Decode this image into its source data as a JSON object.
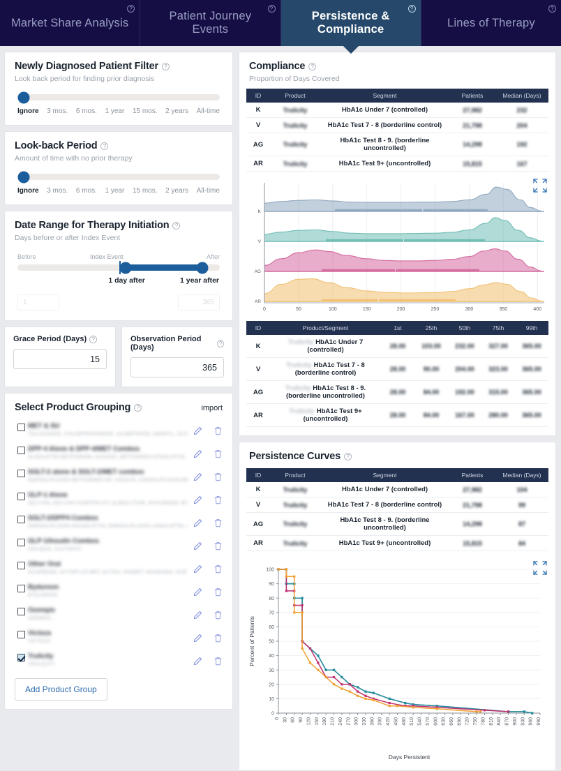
{
  "tabs": [
    {
      "label": "Market Share Analysis",
      "active": false
    },
    {
      "label": "Patient Journey Events",
      "active": false
    },
    {
      "label": "Persistence & Compliance",
      "active": true
    },
    {
      "label": "Lines of Therapy",
      "active": false
    }
  ],
  "newly_diagnosed": {
    "title": "Newly Diagnosed Patient Filter",
    "subtitle": "Look back period for finding prior diagnosis",
    "ticks": [
      "Ignore",
      "3 mos.",
      "6 mos.",
      "1 year",
      "15 mos.",
      "2 years",
      "All-time"
    ],
    "selected": "Ignore"
  },
  "lookback": {
    "title": "Look-back Period",
    "subtitle": "Amount of time with no prior therapy",
    "ticks": [
      "Ignore",
      "3 mos.",
      "6 mos.",
      "1 year",
      "15 mos.",
      "2 years",
      "All-time"
    ],
    "selected": "Ignore"
  },
  "date_range": {
    "title": "Date Range for Therapy Initiation",
    "subtitle": "Days before or after Index Event",
    "left_label": "Before",
    "mid_label": "Index Event",
    "right_label": "After",
    "low_value_label": "1 day after",
    "high_value_label": "1 year after",
    "low_input": "1",
    "high_input": "365"
  },
  "grace_period": {
    "label": "Grace Period (Days)",
    "value": "15"
  },
  "observation_period": {
    "label": "Observation Period (Days)",
    "value": "365"
  },
  "product_grouping": {
    "title": "Select Product Grouping",
    "import_label": "import",
    "add_button": "Add Product Group",
    "items": [
      {
        "name": "MET & SU",
        "drugs": "TOLAZAMIDE, CHLORPROPAMIDE, GLIMEPIRIDE, AMARYL, GLIPIZ...",
        "checked": false
      },
      {
        "name": "DPP-4 Alone & DPP-4/MET Combos",
        "drugs": "ALOGLIPTIN-METFORMIN, KAZANO, METFORMIN-SITAGLIPTIN, JA...",
        "checked": false
      },
      {
        "name": "SGLT-2 alone & SGLT-2/MET combos",
        "drugs": "EMPAGLIFLOZIN-METFORMIN HR, XIGDUO, CANAGLIFLOZIN-MET...",
        "checked": false
      },
      {
        "name": "GLP-1 Alone",
        "drugs": "ADLYXIN, ADLYXIN STARTER KIT, ALBIGLUTIDE, BYDUREON, BYETT...",
        "checked": false
      },
      {
        "name": "SGLT-2/DPP4 Combos",
        "drugs": "EMPAGLIFLOZIN-SAXAGLIPTIN, EMPAGLIFLOZIN-LINAGLIPTIN, GL...",
        "checked": false
      },
      {
        "name": "GLP-1/Insulin Combos",
        "drugs": "SOLIQUA, XULTOPHY",
        "checked": false
      },
      {
        "name": "Other Oral",
        "drugs": "ACARBOSE, ACTOPLUS MET, ACTOS, RIOMET, INVOKANA, DUET...",
        "checked": false
      },
      {
        "name": "Bydureon",
        "drugs": "BYDUREON",
        "checked": false
      },
      {
        "name": "Ozempic",
        "drugs": "OZEMPIC",
        "checked": false
      },
      {
        "name": "Victoza",
        "drugs": "VICTOZA",
        "checked": false
      },
      {
        "name": "Trulicity",
        "drugs": "TRULICITY",
        "checked": true
      }
    ]
  },
  "compliance": {
    "title": "Compliance",
    "subtitle": "Proportion of Days Covered",
    "columns": [
      "ID",
      "Product",
      "Segment",
      "Patients",
      "Median (Days)"
    ],
    "rows": [
      {
        "id": "K",
        "product": "Trulicity",
        "segment": "HbA1c Under 7 (controlled)",
        "patients": "27,982",
        "median": "232"
      },
      {
        "id": "V",
        "product": "Trulicity",
        "segment": "HbA1c Test 7 - 8 (borderline control)",
        "patients": "21,798",
        "median": "204"
      },
      {
        "id": "AG",
        "product": "Trulicity",
        "segment": "HbA1c Test 8 - 9. (borderline uncontrolled)",
        "patients": "14,298",
        "median": "192"
      },
      {
        "id": "AR",
        "product": "Trulicity",
        "segment": "HbA1c Test 9+ (uncontrolled)",
        "patients": "15,815",
        "median": "167"
      }
    ],
    "quantile_columns": [
      "ID",
      "Product/Segment",
      "1st",
      "25th",
      "50th",
      "75th",
      "99th"
    ],
    "quantile_rows": [
      {
        "id": "K",
        "product": "Trulicity",
        "segment": "HbA1c Under 7 (controlled)",
        "q1": "28.00",
        "q25": "103.00",
        "q50": "232.00",
        "q75": "327.00",
        "q99": "365.00"
      },
      {
        "id": "V",
        "product": "Trulicity",
        "segment": "HbA1c Test 7 - 8 (borderline control)",
        "q1": "28.00",
        "q25": "90.00",
        "q50": "204.00",
        "q75": "323.00",
        "q99": "365.00"
      },
      {
        "id": "AG",
        "product": "Trulicity",
        "segment": "HbA1c Test 8 - 9. (borderline uncontrolled)",
        "q1": "28.00",
        "q25": "84.00",
        "q50": "192.00",
        "q75": "315.00",
        "q99": "365.00"
      },
      {
        "id": "AR",
        "product": "Trulicity",
        "segment": "HbA1c Test 9+ (uncontrolled)",
        "q1": "28.00",
        "q25": "84.00",
        "q50": "167.00",
        "q75": "280.00",
        "q99": "365.00"
      }
    ]
  },
  "persistence": {
    "title": "Persistence Curves",
    "columns": [
      "ID",
      "Product",
      "Segment",
      "Patients",
      "Median (Days)"
    ],
    "rows": [
      {
        "id": "K",
        "product": "Trulicity",
        "segment": "HbA1c Under 7 (controlled)",
        "patients": "27,982",
        "median": "104"
      },
      {
        "id": "V",
        "product": "Trulicity",
        "segment": "HbA1c Test 7 - 8 (borderline control)",
        "patients": "21,798",
        "median": "99"
      },
      {
        "id": "AG",
        "product": "Trulicity",
        "segment": "HbA1c Test 8 - 9. (borderline uncontrolled)",
        "patients": "14,298",
        "median": "87"
      },
      {
        "id": "AR",
        "product": "Trulicity",
        "segment": "HbA1c Test 9+ (uncontrolled)",
        "patients": "15,815",
        "median": "84"
      }
    ]
  },
  "chart_data": [
    {
      "type": "area",
      "name": "compliance-ridgeline",
      "title": "",
      "xlabel": "",
      "ylabel": "",
      "xlim": [
        0,
        410
      ],
      "xticks": [
        0,
        50,
        100,
        150,
        200,
        250,
        300,
        350,
        400
      ],
      "ytick_labels": [
        "K",
        "V",
        "AG",
        "AR"
      ],
      "grid": true,
      "legend": "none",
      "series": [
        {
          "name": "K",
          "color": "#8fa8c0",
          "x": [
            0,
            25,
            50,
            75,
            100,
            125,
            150,
            175,
            200,
            225,
            250,
            275,
            300,
            325,
            340,
            355,
            375,
            390,
            405
          ],
          "density": [
            0.3,
            0.36,
            0.4,
            0.42,
            0.38,
            0.34,
            0.33,
            0.33,
            0.33,
            0.34,
            0.34,
            0.36,
            0.42,
            0.62,
            0.88,
            0.8,
            0.42,
            0.14,
            0.02
          ],
          "box": {
            "q25": 103,
            "median": 232,
            "q75": 327
          }
        },
        {
          "name": "V",
          "color": "#6fbdb5",
          "x": [
            0,
            25,
            50,
            75,
            100,
            125,
            150,
            175,
            200,
            225,
            250,
            275,
            300,
            325,
            338,
            352,
            372,
            390,
            405
          ],
          "density": [
            0.26,
            0.34,
            0.4,
            0.42,
            0.36,
            0.3,
            0.28,
            0.28,
            0.28,
            0.29,
            0.3,
            0.33,
            0.42,
            0.66,
            0.86,
            0.76,
            0.4,
            0.13,
            0.02
          ],
          "box": {
            "q25": 90,
            "median": 204,
            "q75": 323
          }
        },
        {
          "name": "AG",
          "color": "#d46a9e",
          "x": [
            0,
            25,
            50,
            75,
            95,
            120,
            150,
            175,
            200,
            225,
            250,
            275,
            300,
            322,
            338,
            352,
            372,
            390,
            405
          ],
          "density": [
            0.22,
            0.46,
            0.68,
            0.78,
            0.72,
            0.58,
            0.46,
            0.4,
            0.38,
            0.38,
            0.4,
            0.44,
            0.54,
            0.74,
            0.82,
            0.74,
            0.44,
            0.16,
            0.02
          ],
          "box": {
            "q25": 84,
            "median": 192,
            "q75": 315
          }
        },
        {
          "name": "AR",
          "color": "#f0c070",
          "x": [
            0,
            25,
            50,
            70,
            95,
            120,
            150,
            175,
            200,
            225,
            250,
            275,
            300,
            322,
            340,
            355,
            375,
            392,
            405
          ],
          "density": [
            0.28,
            0.62,
            0.8,
            0.82,
            0.68,
            0.5,
            0.38,
            0.33,
            0.31,
            0.31,
            0.32,
            0.36,
            0.46,
            0.6,
            0.68,
            0.62,
            0.36,
            0.12,
            0.02
          ],
          "box": {
            "q25": 84,
            "median": 167,
            "q75": 280
          }
        }
      ]
    },
    {
      "type": "line",
      "name": "persistence-curves",
      "title": "",
      "xlabel": "Days Persistent",
      "ylabel": "Percent of Patients",
      "xlim": [
        0,
        990
      ],
      "ylim": [
        0,
        100
      ],
      "xticks": [
        0,
        30,
        60,
        90,
        120,
        150,
        180,
        210,
        240,
        270,
        300,
        330,
        360,
        390,
        420,
        450,
        480,
        510,
        540,
        570,
        600,
        630,
        660,
        690,
        720,
        750,
        780,
        810,
        840,
        870,
        900,
        930,
        960,
        990
      ],
      "yticks": [
        0,
        10,
        20,
        30,
        40,
        50,
        60,
        70,
        80,
        90,
        100
      ],
      "grid": true,
      "legend": "none",
      "series": [
        {
          "name": "K",
          "color": "#1b6e80",
          "x": [
            0,
            30,
            30,
            60,
            60,
            90,
            90,
            120,
            150,
            180,
            210,
            240,
            270,
            300,
            330,
            360,
            420,
            480,
            510,
            600,
            870,
            930,
            960
          ],
          "y": [
            100,
            100,
            90,
            90,
            80,
            80,
            50,
            45,
            40,
            30,
            30,
            25,
            20,
            18,
            15,
            14,
            10,
            7,
            6,
            5,
            1,
            1,
            0
          ]
        },
        {
          "name": "V",
          "color": "#2a8fa0",
          "x": [
            0,
            30,
            30,
            60,
            60,
            90,
            90,
            120,
            150,
            180,
            210,
            240,
            270,
            300,
            330,
            360,
            420,
            480,
            510,
            600,
            870,
            930,
            960
          ],
          "y": [
            100,
            100,
            90,
            90,
            80,
            80,
            50,
            45,
            40,
            30,
            30,
            25,
            20,
            18,
            15,
            14,
            10,
            7,
            6,
            5,
            1,
            1,
            0
          ]
        },
        {
          "name": "AG",
          "color": "#bf2f6e",
          "x": [
            0,
            30,
            30,
            60,
            60,
            90,
            90,
            120,
            150,
            180,
            210,
            240,
            270,
            300,
            330,
            360,
            420,
            480,
            510,
            600,
            780,
            870
          ],
          "y": [
            100,
            100,
            85,
            85,
            75,
            75,
            50,
            45,
            35,
            25,
            25,
            20,
            20,
            15,
            12,
            10,
            7,
            5,
            5,
            4,
            2,
            1
          ]
        },
        {
          "name": "AR",
          "color": "#f0a030",
          "x": [
            0,
            30,
            30,
            60,
            60,
            90,
            90,
            120,
            150,
            180,
            210,
            240,
            270,
            300,
            330,
            360,
            420,
            450,
            510,
            600,
            750,
            765
          ],
          "y": [
            100,
            100,
            95,
            95,
            70,
            70,
            45,
            35,
            30,
            25,
            20,
            17,
            15,
            12,
            10,
            9,
            5,
            5,
            4,
            3,
            1,
            1
          ]
        }
      ]
    }
  ]
}
